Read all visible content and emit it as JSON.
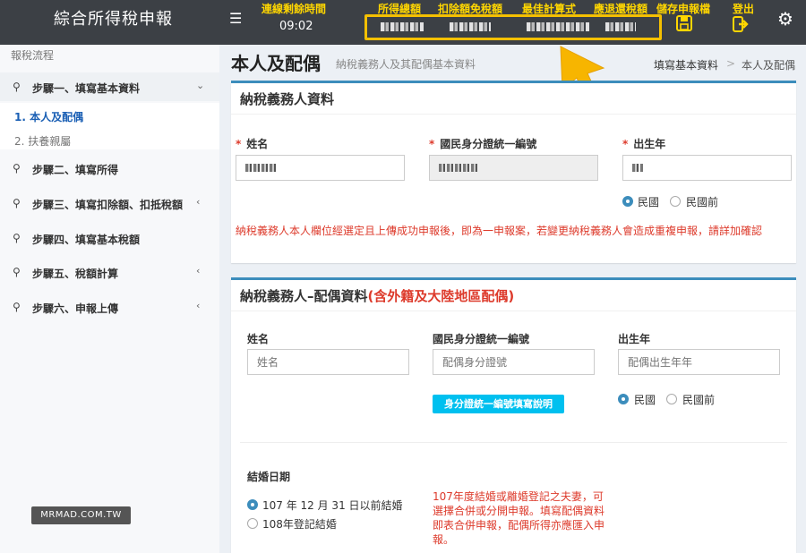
{
  "header": {
    "app_title": "綜合所得稅申報",
    "menu_icon": "hamburger-icon",
    "time_label": "連線剩餘時間",
    "time_value": "09:02",
    "summary_labels": [
      "所得總額",
      "扣除額免稅額",
      "最佳計算式",
      "應退還稅額"
    ],
    "save_label": "儲存申報檔",
    "logout_label": "登出",
    "accent_color": "#ffd600",
    "highlight_color": "#f5c000"
  },
  "sidebar": {
    "title": "報稅流程",
    "steps": [
      {
        "label": "步驟一、填寫基本資料",
        "chevron": "⌄"
      },
      {
        "label": "步驟二、填寫所得",
        "chevron": ""
      },
      {
        "label": "步驟三、填寫扣除額、扣抵稅額",
        "chevron": "‹"
      },
      {
        "label": "步驟四、填寫基本稅額",
        "chevron": ""
      },
      {
        "label": "步驟五、稅額計算",
        "chevron": "‹"
      },
      {
        "label": "步驟六、申報上傳",
        "chevron": "‹"
      }
    ],
    "sub_items": [
      "1. 本人及配偶",
      "2. 扶養親屬"
    ]
  },
  "main": {
    "title": "本人及配偶",
    "subtitle": "納稅義務人及其配偶基本資料",
    "breadcrumb": [
      "填寫基本資料",
      ">",
      "本人及配偶"
    ]
  },
  "taxpayer": {
    "title": "納稅義務人資料",
    "name_label": "姓名",
    "id_label": "國民身分證統一編號",
    "birth_label": "出生年",
    "era_options": [
      "民國",
      "民國前"
    ],
    "warning": "納稅義務人本人欄位經選定且上傳成功申報後，即為一申報案，若變更納稅義務人會造成重複申報，請詳加確認"
  },
  "spouse": {
    "title": "納稅義務人–配偶資料",
    "title_note": "(含外籍及大陸地區配偶)",
    "name_label": "姓名",
    "name_placeholder": "姓名",
    "id_label": "國民身分證統一編號",
    "id_placeholder": "配偶身分證號",
    "birth_label": "出生年",
    "birth_placeholder": "配偶出生年年",
    "id_help_button": "身分證統一編號填寫說明",
    "era_options": [
      "民國",
      "民國前"
    ],
    "marriage_label": "結婚日期",
    "marriage_options": [
      "107 年 12 月 31 日以前結婚",
      "108年登記結婚"
    ],
    "marriage_notice": "107年度結婚或離婚登記之夫妻，可選擇合併或分開申報。填寫配偶資料即表合併申報，配偶所得亦應匯入申報。"
  },
  "watermark": "MRMAD.COM.TW"
}
